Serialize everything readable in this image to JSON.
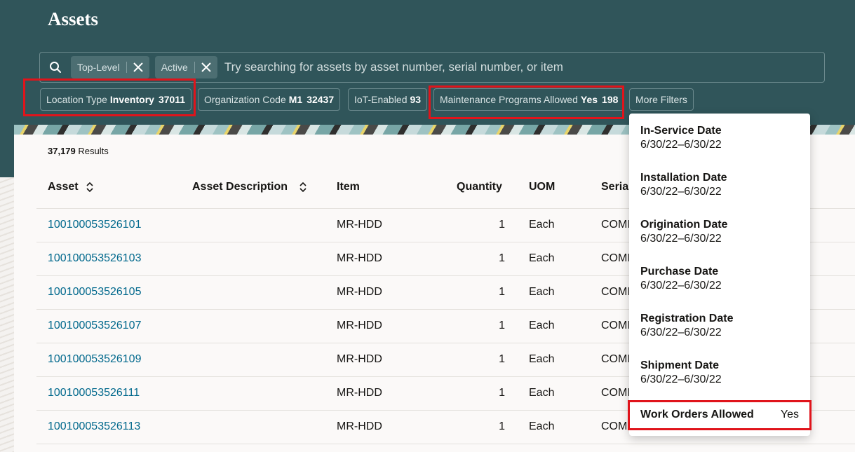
{
  "header": {
    "title": "Assets",
    "search": {
      "chips": [
        {
          "label": "Top-Level"
        },
        {
          "label": "Active"
        }
      ],
      "placeholder": "Try searching for assets by asset number, serial number, or item"
    },
    "filters": {
      "location_type": {
        "label": "Location Type",
        "value": "Inventory",
        "count": "37011"
      },
      "organization_code": {
        "label": "Organization Code",
        "value": "M1",
        "count": "32437"
      },
      "iot_enabled": {
        "label": "IoT-Enabled",
        "count": "93"
      },
      "maintenance_programs": {
        "label": "Maintenance Programs Allowed",
        "value": "Yes",
        "count": "198"
      },
      "more_filters": {
        "label": "More Filters"
      }
    }
  },
  "results": {
    "count": "37,179",
    "label": "Results"
  },
  "table": {
    "columns": {
      "asset": "Asset",
      "asset_description": "Asset Description",
      "item": "Item",
      "quantity": "Quantity",
      "uom": "UOM",
      "serial": "Serial"
    },
    "rows": [
      {
        "asset": "100100053526101",
        "item": "MR-HDD",
        "quantity": "1",
        "uom": "Each",
        "serial": "COMI"
      },
      {
        "asset": "100100053526103",
        "item": "MR-HDD",
        "quantity": "1",
        "uom": "Each",
        "serial": "COMI"
      },
      {
        "asset": "100100053526105",
        "item": "MR-HDD",
        "quantity": "1",
        "uom": "Each",
        "serial": "COMI"
      },
      {
        "asset": "100100053526107",
        "item": "MR-HDD",
        "quantity": "1",
        "uom": "Each",
        "serial": "COMI"
      },
      {
        "asset": "100100053526109",
        "item": "MR-HDD",
        "quantity": "1",
        "uom": "Each",
        "serial": "COMI"
      },
      {
        "asset": "100100053526111",
        "item": "MR-HDD",
        "quantity": "1",
        "uom": "Each",
        "serial": "COMI"
      },
      {
        "asset": "100100053526113",
        "item": "MR-HDD",
        "quantity": "1",
        "uom": "Each",
        "serial": "COM"
      }
    ]
  },
  "more_filters_menu": {
    "items": [
      {
        "label": "In-Service Date",
        "value": "6/30/22–6/30/22"
      },
      {
        "label": "Installation Date",
        "value": "6/30/22–6/30/22"
      },
      {
        "label": "Origination Date",
        "value": "6/30/22–6/30/22"
      },
      {
        "label": "Purchase Date",
        "value": "6/30/22–6/30/22"
      },
      {
        "label": "Registration Date",
        "value": "6/30/22–6/30/22"
      },
      {
        "label": "Shipment Date",
        "value": "6/30/22–6/30/22"
      }
    ],
    "work_orders_allowed": {
      "label": "Work Orders Allowed",
      "value": "Yes"
    }
  },
  "colors": {
    "header_background": "#30555a",
    "link": "#00688c",
    "highlight": "#e0141b"
  },
  "icons": [
    "search-icon",
    "close-icon",
    "sort-icon"
  ]
}
